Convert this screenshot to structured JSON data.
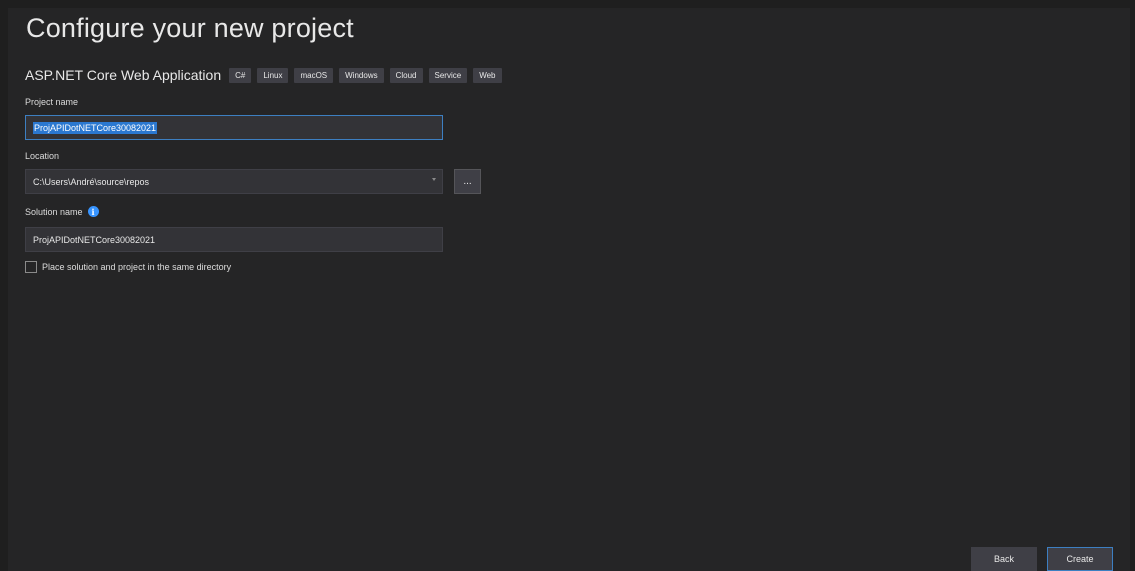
{
  "page": {
    "title": "Configure your new project"
  },
  "template": {
    "name": "ASP.NET Core Web Application",
    "tags": [
      "C#",
      "Linux",
      "macOS",
      "Windows",
      "Cloud",
      "Service",
      "Web"
    ]
  },
  "project_name": {
    "label": "Project name",
    "value": "ProjAPIDotNETCore30082021"
  },
  "location": {
    "label": "Location",
    "value": "C:\\Users\\André\\source\\repos",
    "browse_label": "..."
  },
  "solution_name": {
    "label": "Solution name",
    "info_icon": "i",
    "value": "ProjAPIDotNETCore30082021"
  },
  "same_directory": {
    "label": "Place solution and project in the same directory",
    "checked": false
  },
  "footer": {
    "back_label": "Back",
    "create_label": "Create"
  },
  "colors": {
    "background": "#252526",
    "accent": "#3d7fc1",
    "selection": "#2b78d0",
    "info": "#3794ff"
  }
}
